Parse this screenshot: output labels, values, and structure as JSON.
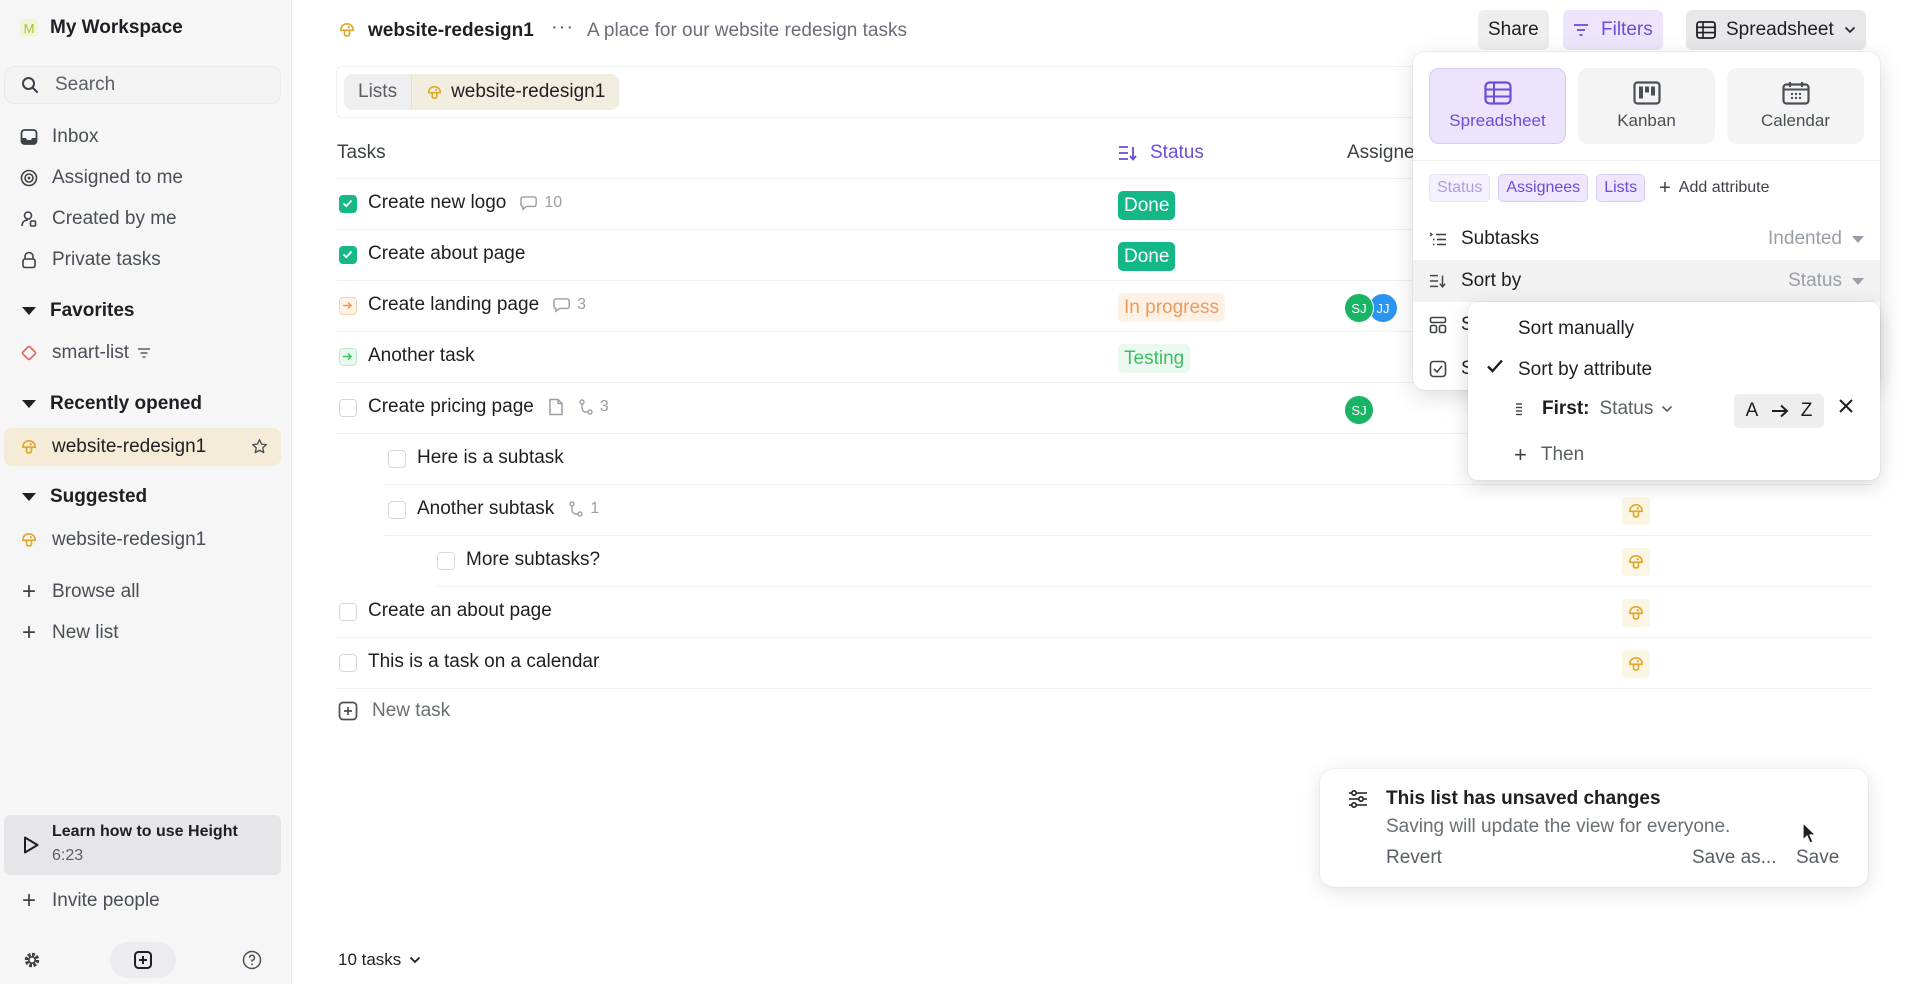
{
  "workspace": {
    "initial": "M",
    "name": "My Workspace"
  },
  "sidebar": {
    "search_label": "Search",
    "nav": [
      {
        "icon": "inbox-icon",
        "label": "Inbox"
      },
      {
        "icon": "target-icon",
        "label": "Assigned to me"
      },
      {
        "icon": "user-icon",
        "label": "Created by me"
      },
      {
        "icon": "lock-icon",
        "label": "Private tasks"
      }
    ],
    "favorites": {
      "heading": "Favorites",
      "items": [
        {
          "icon": "diamond-icon",
          "label": "smart-list"
        }
      ]
    },
    "recent": {
      "heading": "Recently opened",
      "items": [
        {
          "icon": "mushroom-icon",
          "label": "website-redesign1"
        }
      ]
    },
    "suggested": {
      "heading": "Suggested",
      "items": [
        {
          "icon": "mushroom-icon",
          "label": "website-redesign1"
        }
      ]
    },
    "browse_all": "Browse all",
    "new_list": "New list",
    "learn": {
      "title": "Learn how to use Height",
      "duration": "6:23"
    },
    "invite": "Invite people"
  },
  "header": {
    "list_name": "website-redesign1",
    "description": "A place for our website redesign tasks",
    "more": "···",
    "share": "Share",
    "filters": "Filters",
    "view": "Spreadsheet"
  },
  "breadcrumb": {
    "root": "Lists",
    "current": "website-redesign1"
  },
  "table": {
    "columns": {
      "tasks": "Tasks",
      "status": "Status",
      "assignees": "Assigne"
    },
    "rows": [
      {
        "title": "Create new logo",
        "state": "done",
        "level": 0,
        "comments": "10",
        "status": "Done",
        "status_kind": "done",
        "assignees": []
      },
      {
        "title": "Create about page",
        "state": "done",
        "level": 0,
        "status": "Done",
        "status_kind": "done",
        "assignees": []
      },
      {
        "title": "Create landing page",
        "state": "prog",
        "level": 0,
        "comments": "3",
        "status": "In progress",
        "status_kind": "prog",
        "assignees": [
          "SJ",
          "JJ"
        ]
      },
      {
        "title": "Another task",
        "state": "test",
        "level": 0,
        "status": "Testing",
        "status_kind": "test",
        "assignees": []
      },
      {
        "title": "Create pricing page",
        "state": "todo",
        "level": 0,
        "has_doc": true,
        "subtasks": "3",
        "assignees": [
          "SJ"
        ]
      },
      {
        "title": "Here is a subtask",
        "state": "todo",
        "level": 1,
        "assignees": []
      },
      {
        "title": "Another subtask",
        "state": "todo",
        "level": 1,
        "subtasks": "1",
        "assignees": [],
        "list_icon": true
      },
      {
        "title": "More subtasks?",
        "state": "todo",
        "level": 2,
        "assignees": [],
        "list_icon": true
      },
      {
        "title": "Create an about page",
        "state": "todo",
        "level": 0,
        "assignees": [],
        "list_icon": true
      },
      {
        "title": "This is a task on a calendar",
        "state": "todo",
        "level": 0,
        "assignees": [],
        "list_icon": true
      }
    ],
    "new_task": "New task",
    "count": "10 tasks"
  },
  "view_popover": {
    "views": [
      {
        "label": "Spreadsheet",
        "active": true
      },
      {
        "label": "Kanban",
        "active": false
      },
      {
        "label": "Calendar",
        "active": false
      }
    ],
    "attributes": [
      "Status",
      "Assignees",
      "Lists"
    ],
    "add_attribute": "Add attribute",
    "subtasks": {
      "label": "Subtasks",
      "value": "Indented"
    },
    "sort_by": {
      "label": "Sort by",
      "value": "Status"
    },
    "row3_initial": "S",
    "row4_initial": "S"
  },
  "sort_menu": {
    "manual": "Sort manually",
    "by_attribute": "Sort by attribute",
    "first_label": "First:",
    "first_value": "Status",
    "order_from": "A",
    "order_to": "Z",
    "then": "Then"
  },
  "toast": {
    "title": "This list has unsaved changes",
    "body": "Saving will update the view for everyone.",
    "revert": "Revert",
    "save_as": "Save as...",
    "save": "Save"
  },
  "colors": {
    "accent": "#6c4dd8",
    "done": "#14b886",
    "in_progress": "#ef9a5a",
    "testing": "#3fbf64",
    "list_icon": "#e0a82e"
  }
}
